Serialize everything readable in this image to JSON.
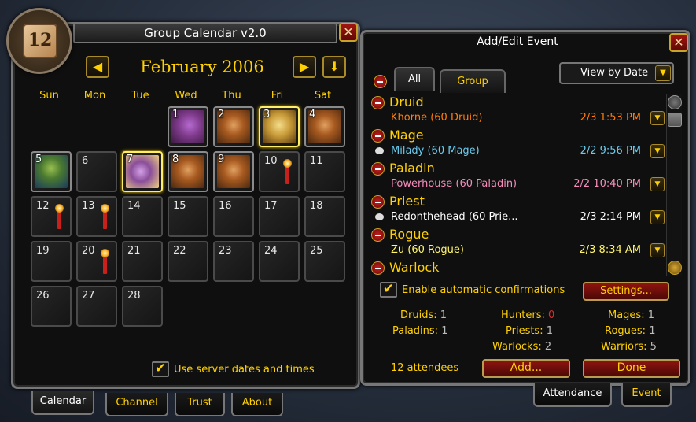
{
  "calendar_window": {
    "title": "Group Calendar v2.0",
    "logo_number": "12",
    "close_label": "✕",
    "month_title": "February 2006",
    "prev_label": "◀",
    "next_label": "▶",
    "today_label": "⬇",
    "day_headers": [
      "Sun",
      "Mon",
      "Tue",
      "Wed",
      "Thu",
      "Fri",
      "Sat"
    ],
    "days": [
      {
        "n": "1",
        "icon": "troll"
      },
      {
        "n": "2",
        "icon": "orc"
      },
      {
        "n": "3",
        "icon": "tauren",
        "highlight": true
      },
      {
        "n": "4",
        "icon": "orc"
      },
      {
        "n": "5",
        "icon": "tree"
      },
      {
        "n": "6"
      },
      {
        "n": "7",
        "icon": "troll2",
        "today": true
      },
      {
        "n": "8",
        "icon": "orc"
      },
      {
        "n": "9",
        "icon": "orc"
      },
      {
        "n": "10",
        "candle": true
      },
      {
        "n": "11"
      },
      {
        "n": "12",
        "candle": true
      },
      {
        "n": "13",
        "candle": true
      },
      {
        "n": "14"
      },
      {
        "n": "15"
      },
      {
        "n": "16"
      },
      {
        "n": "17"
      },
      {
        "n": "18"
      },
      {
        "n": "19"
      },
      {
        "n": "20",
        "candle": true
      },
      {
        "n": "21"
      },
      {
        "n": "22"
      },
      {
        "n": "23"
      },
      {
        "n": "24"
      },
      {
        "n": "25"
      },
      {
        "n": "26"
      },
      {
        "n": "27"
      },
      {
        "n": "28"
      }
    ],
    "server_dates_label": "Use server dates and times",
    "server_dates_checked": true,
    "tabs": [
      "Calendar",
      "Channel",
      "Trust",
      "About"
    ],
    "active_tab": "Calendar"
  },
  "event_window": {
    "title": "Add/Edit Event",
    "close_label": "✕",
    "filter_tabs": [
      "All",
      "Group"
    ],
    "active_filter": "All",
    "view_by": "View by Date",
    "groups": [
      {
        "class": "Druid",
        "members": [
          {
            "name": "Khorne (60 Druid)",
            "time": "2/3 1:53 PM",
            "color": "#ff7d0a"
          }
        ]
      },
      {
        "class": "Mage",
        "members": [
          {
            "name": "Milady (60 Mage)",
            "time": "2/2 9:56 PM",
            "color": "#69ccf0",
            "whisper": true
          }
        ]
      },
      {
        "class": "Paladin",
        "members": [
          {
            "name": "Powerhouse (60 Paladin)",
            "time": "2/2 10:40 PM",
            "color": "#f58cba"
          }
        ]
      },
      {
        "class": "Priest",
        "members": [
          {
            "name": "Redonthehead (60 Prie...",
            "time": "2/3 2:14 PM",
            "color": "#ffffff",
            "whisper": true
          }
        ]
      },
      {
        "class": "Rogue",
        "members": [
          {
            "name": "Zu (60 Rogue)",
            "time": "2/3 8:34 AM",
            "color": "#fff569"
          }
        ]
      },
      {
        "class": "Warlock",
        "members": []
      }
    ],
    "auto_confirm_label": "Enable automatic confirmations",
    "auto_confirm_checked": true,
    "settings_label": "Settings...",
    "summary": {
      "druids": {
        "label": "Druids:",
        "value": "1"
      },
      "hunters": {
        "label": "Hunters:",
        "value": "0"
      },
      "mages": {
        "label": "Mages:",
        "value": "1"
      },
      "paladins": {
        "label": "Paladins:",
        "value": "1"
      },
      "priests": {
        "label": "Priests:",
        "value": "1"
      },
      "rogues": {
        "label": "Rogues:",
        "value": "1"
      },
      "warlocks": {
        "label": "Warlocks:",
        "value": "2"
      },
      "warriors": {
        "label": "Warriors:",
        "value": "5"
      }
    },
    "attendee_count": "12 attendees",
    "add_label": "Add...",
    "done_label": "Done",
    "tabs": [
      "Attendance",
      "Event"
    ],
    "active_tab": "Attendance"
  }
}
